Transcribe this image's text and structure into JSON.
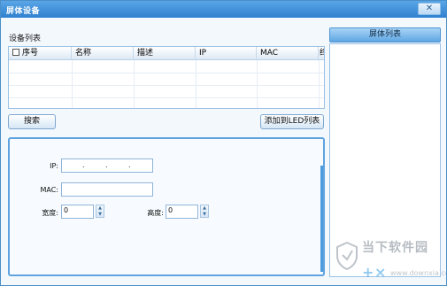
{
  "window": {
    "title": "屏体设备",
    "close_symbol": "✕"
  },
  "device_list": {
    "label": "设备列表",
    "columns": [
      "序号",
      "名称",
      "描述",
      "IP",
      "MAC",
      "终"
    ],
    "rows": []
  },
  "buttons": {
    "search": "搜索",
    "add_to_led": "添加到LED列表"
  },
  "properties": {
    "ip_label": "IP:",
    "ip_dot": ".",
    "mac_label": "MAC:",
    "mac_value": "",
    "width_label": "宽度:",
    "width_value": "0",
    "height_label": "高度:",
    "height_value": "0",
    "spin_up": "▲",
    "spin_down": "▼"
  },
  "screen_list": {
    "label": "屏体列表",
    "items": []
  },
  "watermark": {
    "line1": "当下软件园",
    "line2": "www.downxia.com",
    "icon": "shield-logo-icon"
  }
}
